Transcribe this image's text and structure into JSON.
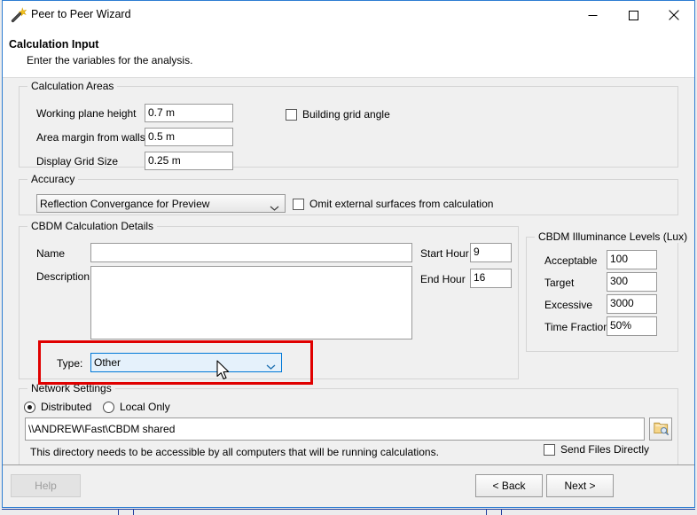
{
  "window": {
    "title": "Peer to Peer Wizard",
    "icon": "magic-wand-icon",
    "minimize_label": "Minimize",
    "maximize_label": "Maximize",
    "close_label": "Close",
    "border_color": "#2d7dd2"
  },
  "header": {
    "title": "Calculation Input",
    "subtitle": "Enter the variables for the analysis."
  },
  "calculation_areas": {
    "legend": "Calculation Areas",
    "fields": [
      {
        "label": "Working plane height",
        "value": "0.7 m"
      },
      {
        "label": "Area margin from walls",
        "value": "0.5 m"
      },
      {
        "label": "Display Grid Size",
        "value": "0.25 m"
      }
    ],
    "building_grid_angle": {
      "label": "Building grid angle",
      "checked": false
    }
  },
  "accuracy": {
    "legend": "Accuracy",
    "selected": "Reflection Convergance for Preview",
    "omit_external": {
      "label": "Omit external surfaces from calculation",
      "checked": false
    }
  },
  "cbdm_details": {
    "legend": "CBDM Calculation Details",
    "name_label": "Name",
    "name_value": "",
    "name_placeholder": "",
    "description_label": "Description",
    "description_value": "",
    "description_placeholder": "",
    "start_hour_label": "Start Hour",
    "start_hour_value": "9",
    "end_hour_label": "End Hour",
    "end_hour_value": "16",
    "type_label": "Type:",
    "type_value": "Other"
  },
  "illuminance": {
    "legend": "CBDM Illuminance Levels (Lux)",
    "rows": [
      {
        "label": "Acceptable",
        "value": "100"
      },
      {
        "label": "Target",
        "value": "300"
      },
      {
        "label": "Excessive",
        "value": "3000"
      },
      {
        "label": "Time Fraction",
        "value": "50%"
      }
    ]
  },
  "network": {
    "legend": "Network Settings",
    "mode_distributed": "Distributed",
    "mode_local": "Local Only",
    "selected_mode": "Distributed",
    "path_value": "\\\\ANDREW\\Fast\\CBDM shared",
    "browse_icon": "folder-browse-icon",
    "hint": "This directory needs to be accessible by all computers that will be running calculations.",
    "send_files_directly": {
      "label": "Send Files Directly",
      "checked": false
    }
  },
  "footer": {
    "help_label": "Help",
    "back_label": "< Back",
    "next_label": "Next >"
  },
  "annotation": {
    "highlight_color": "#e00000",
    "highlight_target": "type-combobox"
  }
}
